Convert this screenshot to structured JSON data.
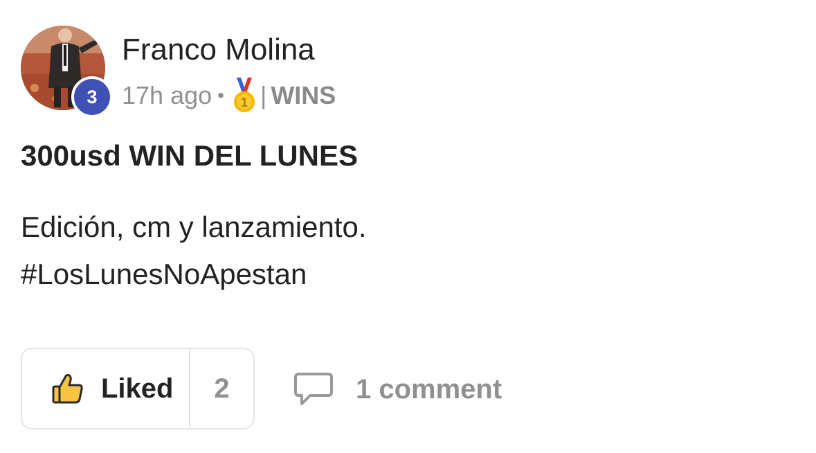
{
  "post": {
    "author": {
      "name": "Franco Molina",
      "level": "3"
    },
    "meta": {
      "time": "17h ago",
      "separator_dot": "•",
      "medal_icon": "first-place-medal-icon",
      "divider": "|",
      "category": "WINS"
    },
    "title": "300usd WIN DEL LUNES",
    "body_lines": [
      "Edición, cm y lanzamiento.",
      "#LosLunesNoApestan"
    ],
    "actions": {
      "like_label": "Liked",
      "like_count": "2",
      "like_icon": "thumbs-up-icon",
      "comment_label": "1 comment",
      "comment_icon": "speech-bubble-icon"
    }
  },
  "colors": {
    "level_badge": "#3f51b5",
    "muted_text": "#909090",
    "primary_text": "#222222",
    "thumb_fill": "#f5c542",
    "border": "#e4e4e4"
  }
}
